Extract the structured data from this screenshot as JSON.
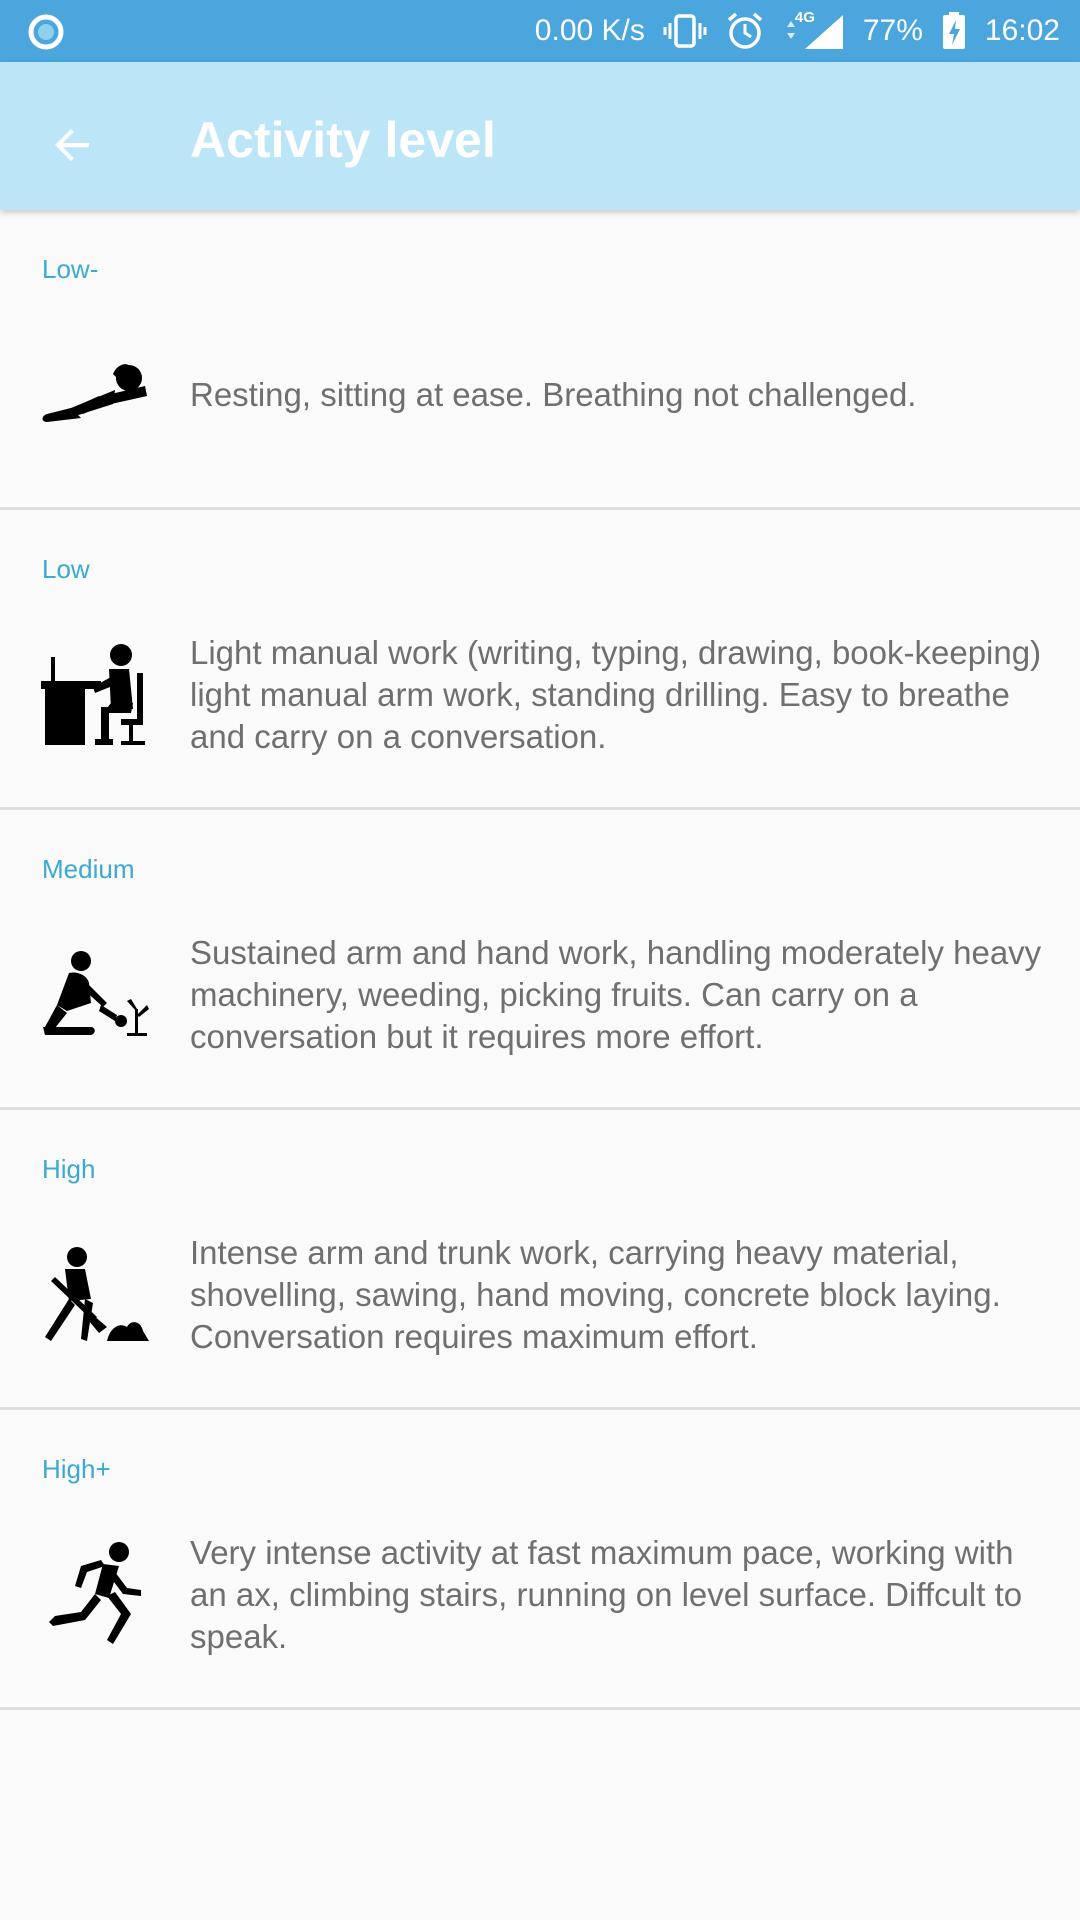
{
  "status_bar": {
    "speed": "0.00 K/s",
    "network": "4G",
    "battery": "77%",
    "time": "16:02",
    "bg_color": "#4aa6dc"
  },
  "app_bar": {
    "title": "Activity level",
    "back_icon": "arrow-back-icon",
    "bg_color": "#bde5f8"
  },
  "levels": [
    {
      "label": "Low-",
      "icon": "resting-person-icon",
      "description": "Resting, sitting at ease. Breathing not challenged."
    },
    {
      "label": "Low",
      "icon": "desk-worker-icon",
      "description": "Light manual work (writing, typing, drawing, book-keeping) light manual arm work, standing drilling. Easy to breathe and carry on a conversation."
    },
    {
      "label": "Medium",
      "icon": "gardener-icon",
      "description": "Sustained arm and hand work, handling moderately heavy machinery, weeding, picking fruits. Can carry on a conversation but it requires more effort."
    },
    {
      "label": "High",
      "icon": "shoveling-person-icon",
      "description": "Intense arm and trunk work, carrying heavy material, shovelling, sawing, hand moving, concrete block laying. Conversation requires maximum effort."
    },
    {
      "label": "High+",
      "icon": "running-person-icon",
      "description": "Very intense activity at fast maximum pace, working with an ax, climbing stairs, running on level surface. Diffcult to speak."
    }
  ],
  "colors": {
    "level_label": "#3ba9d1",
    "description_text": "#6f6f6f",
    "divider": "#dedede"
  }
}
